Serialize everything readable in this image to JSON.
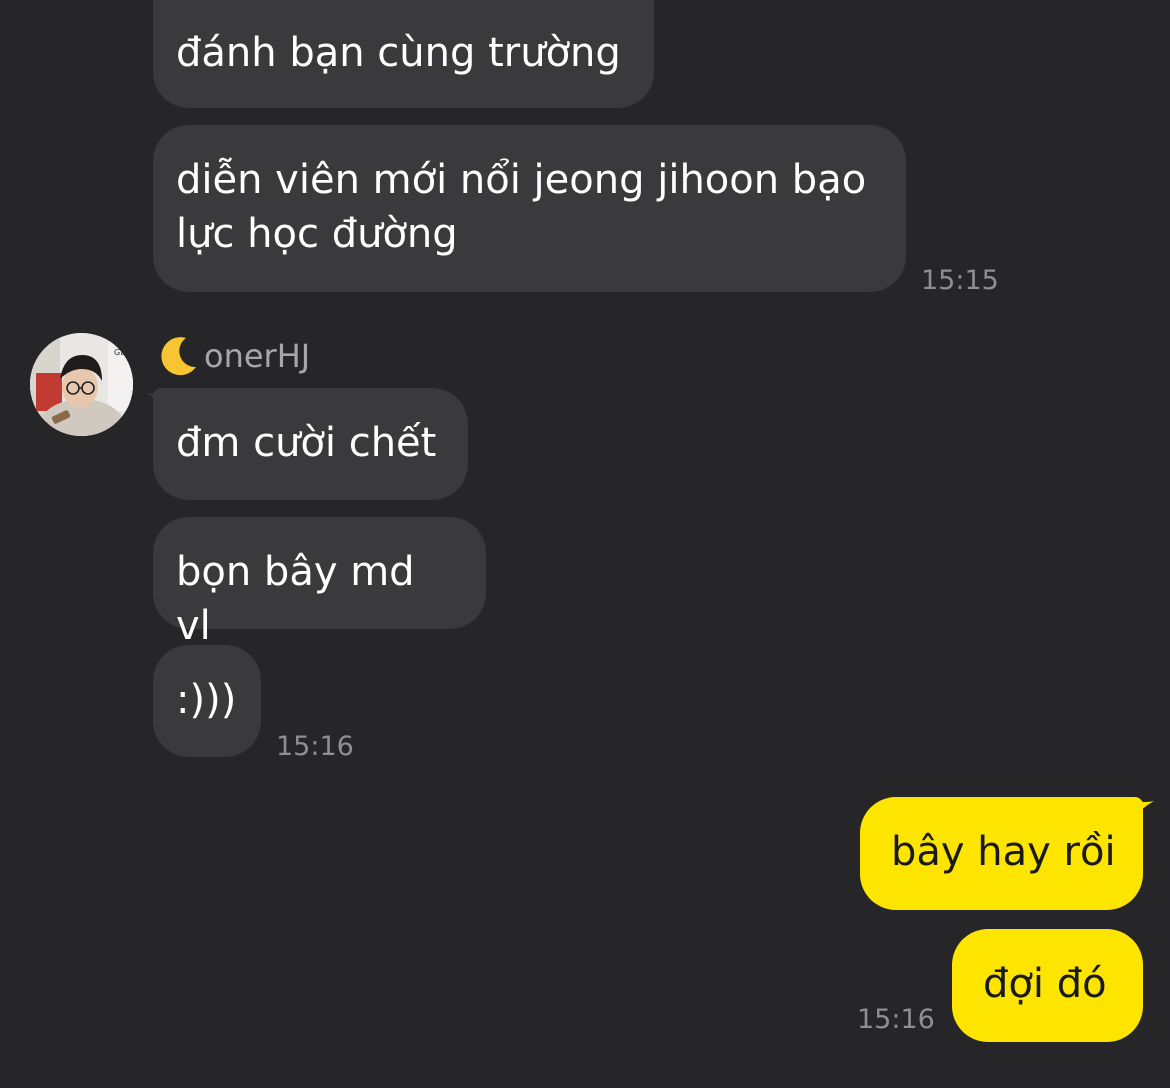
{
  "conversation": {
    "messages": [
      {
        "text": "đánh bạn cùng trường"
      },
      {
        "text": "diễn viên mới nổi jeong jihoon bạo\nlực học đường"
      },
      {
        "text": "đm cười chết"
      },
      {
        "text": "bọn bây md vl"
      },
      {
        "text": ":)))"
      },
      {
        "text": "bây hay rồi"
      },
      {
        "text": "đợi đó"
      }
    ],
    "timestamps": [
      "15:15",
      "15:16",
      "15:16"
    ],
    "sender": {
      "name": "onerHJ",
      "name_icon": "crescent-moon-icon",
      "avatar": "profile-photo"
    }
  },
  "colors": {
    "background": "#262628",
    "incoming_bubble": "#3a3a3c",
    "outgoing_bubble": "#fee500",
    "timestamp": "#8e8e93"
  }
}
